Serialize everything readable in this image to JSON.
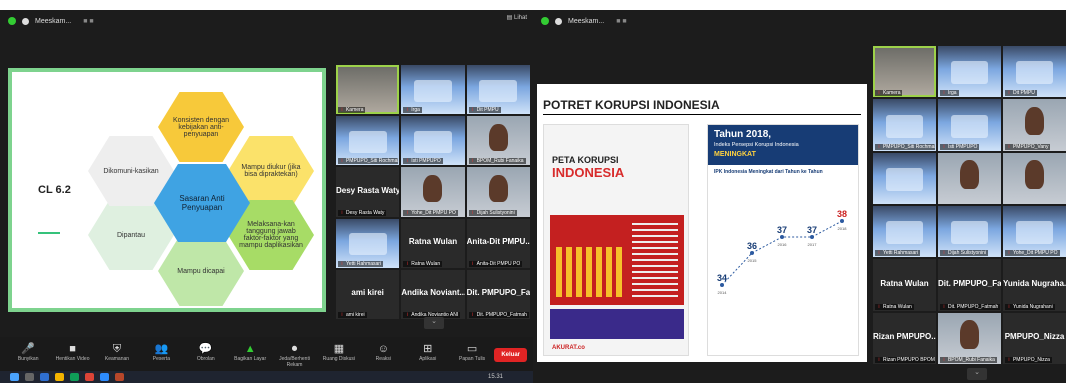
{
  "left": {
    "app_title": "Meeskam...",
    "view_label": "Lihat",
    "slide": {
      "code": "CL 6.2",
      "center": "Sasaran Anti Penyuapan",
      "hex_top": "Konsisten dengan kebijakan anti-penyuapan",
      "hex_tr": "Mampu diukur (jika bisa dipraktekan)",
      "hex_br": "Melaksana-kan tanggung jawab faktor-faktor yang mampu daplikasikan",
      "hex_bottom": "Mampu dicapai",
      "hex_bl": "Dipantau",
      "hex_tl": "Dikomuni-kasikan"
    },
    "tiles": [
      {
        "name": "Kamera",
        "big": ""
      },
      {
        "name": "Irga",
        "big": ""
      },
      {
        "name": "Dit PMPU",
        "big": ""
      },
      {
        "name": "PMPUPO_Siti Rochmah",
        "big": ""
      },
      {
        "name": "Isti PMPUPO",
        "big": ""
      },
      {
        "name": "BPOM_Rubi Fanaika",
        "big": ""
      },
      {
        "name": "Desy Rasta Waty",
        "big": "Desy Rasta Waty"
      },
      {
        "name": "Yohe_Dit PMPU PO",
        "big": ""
      },
      {
        "name": "Dijah Sulistyonini",
        "big": ""
      },
      {
        "name": "Yetti Rahmasari",
        "big": ""
      },
      {
        "name": "Ratna Wulan",
        "big": "Ratna Wulan"
      },
      {
        "name": "Anita-Dit PMPU PO",
        "big": "Anita-Dit PMPU..."
      },
      {
        "name": "ami kirei",
        "big": "ami kirei"
      },
      {
        "name": "Andika Noviantio ANI",
        "big": "Andika Noviant..."
      },
      {
        "name": "Dit. PMPUPO_Fatmah",
        "big": "Dit. PMPUPO_Fa..."
      }
    ],
    "controls": [
      {
        "icon": "🎤",
        "label": "Bunyikan"
      },
      {
        "icon": "■",
        "label": "Hentikan Video"
      },
      {
        "icon": "⛨",
        "label": "Keamanan"
      },
      {
        "icon": "👥",
        "label": "Peserta"
      },
      {
        "icon": "💬",
        "label": "Obrolan"
      },
      {
        "icon": "▲",
        "label": "Bagikan Layar"
      },
      {
        "icon": "⏺",
        "label": "Jeda/Berhenti Rekam"
      },
      {
        "icon": "▦",
        "label": "Ruang Diskusi"
      },
      {
        "icon": "☺",
        "label": "Reaksi"
      },
      {
        "icon": "⊞",
        "label": "Aplikasi"
      },
      {
        "icon": "▭",
        "label": "Papan Tulis"
      }
    ],
    "end_label": "Keluar",
    "participant_count": "29",
    "clock": "15.31"
  },
  "right": {
    "app_title": "Meeskam...",
    "slide": {
      "title": "POTRET KORUPSI INDONESIA",
      "peta_title": "PETA KORUPSI",
      "peta_sub": "INDONESIA",
      "tahun": "Tahun 2018,",
      "ipk_title": "Indeks Persepsi Korupsi Indonesia",
      "meningkat": "MENINGKAT",
      "ipk_note": "IPK Indonesia Meningkat dari Tahun ke Tahun",
      "footer": "AKURAT.co",
      "ipk_values": [
        {
          "year": "2014",
          "value": 34
        },
        {
          "year": "2015",
          "value": 36
        },
        {
          "year": "2016",
          "value": 37
        },
        {
          "year": "2017",
          "value": 37
        },
        {
          "year": "2018",
          "value": 38
        }
      ]
    },
    "tiles": [
      {
        "name": "Kamera",
        "big": ""
      },
      {
        "name": "Irga",
        "big": ""
      },
      {
        "name": "Dit PMPU",
        "big": ""
      },
      {
        "name": "PMPUPO_Siti Rochmah",
        "big": ""
      },
      {
        "name": "Isti PMPUPO",
        "big": ""
      },
      {
        "name": "PMPUPO_Vany",
        "big": ""
      },
      {
        "name": "",
        "big": ""
      },
      {
        "name": "",
        "big": ""
      },
      {
        "name": "",
        "big": ""
      },
      {
        "name": "Yetti Rahmasari",
        "big": ""
      },
      {
        "name": "Dijah Sulistyonini",
        "big": ""
      },
      {
        "name": "Yohe_Dit PMPU PO",
        "big": ""
      },
      {
        "name": "Ratna Wulan",
        "big": "Ratna Wulan"
      },
      {
        "name": "Dit. PMPUPO_Fatmah",
        "big": "Dit. PMPUPO_Fa..."
      },
      {
        "name": "Yunida Nugrahani",
        "big": "Yunida Nugraha..."
      },
      {
        "name": "Rizan PMPUPO BPOM",
        "big": "Rizan PMPUPO..."
      },
      {
        "name": "BPOM_Rubi Fanaika",
        "big": ""
      },
      {
        "name": "PMPUPO_Nizza",
        "big": "PMPUPO_Nizza"
      }
    ]
  }
}
